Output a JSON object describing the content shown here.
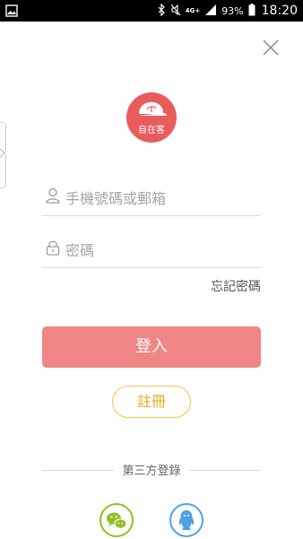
{
  "status_bar": {
    "battery": "93%",
    "time": "18:20",
    "network": "4G+"
  },
  "logo": {
    "text": "自在客"
  },
  "form": {
    "account_placeholder": "手機號碼或郵箱",
    "password_placeholder": "密碼",
    "forgot_password": "忘記密碼",
    "login_label": "登入",
    "register_label": "註冊"
  },
  "third_party": {
    "label": "第三方登錄"
  },
  "colors": {
    "brand_red": "#e85c5e",
    "login_button": "#f08585",
    "register_border": "#f3c53b",
    "wechat": "#8dc21f",
    "qq": "#4fa2e0"
  }
}
